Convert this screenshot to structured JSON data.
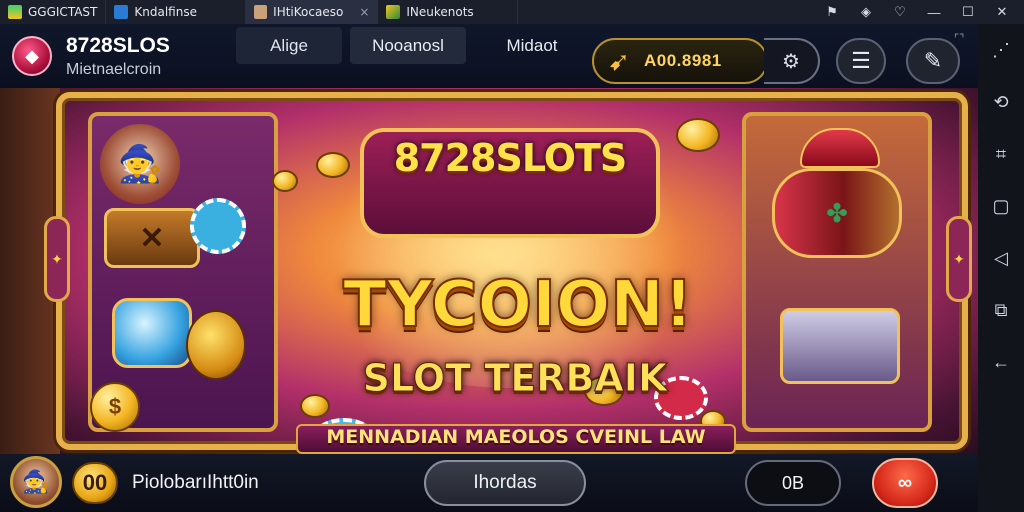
{
  "browser": {
    "tabs": [
      {
        "label": "GGGICTAST",
        "icon": "app-icon"
      },
      {
        "label": "Kndalfinse",
        "icon": "app-icon"
      },
      {
        "label": "IHtiKocaeso",
        "icon": "avatar-icon",
        "close": "×"
      },
      {
        "label": "INeukenots",
        "icon": "app-icon"
      }
    ],
    "window_controls": {
      "pin": "⚑",
      "tool": "◈",
      "heart": "♡",
      "minimize": "—",
      "maximize": "☐",
      "close": "✕"
    }
  },
  "header": {
    "brand_title": "8728SLOS",
    "brand_subtitle": "Mietnaelcroin",
    "nav": [
      "Alige",
      "Nooanosl",
      "Midaot"
    ],
    "coin_value": "A00.8981",
    "corner_ext": "⌜⌝"
  },
  "banner": {
    "brand": "8728SLOTS",
    "title": "TYCOION!",
    "subtitle": "SLOT TERBAIK",
    "tagline": "MENNADIAN MAEOLOS CVEINL LAW"
  },
  "bottom": {
    "badge": "00",
    "username": "PiolobarıIhtt0in",
    "main_button": "Ihordas",
    "small_button": "0B",
    "red_button": "∞"
  },
  "sidebar": {
    "icons": [
      "dots-icon",
      "rotate-icon",
      "crop-icon",
      "square-icon",
      "back-icon",
      "copy-icon",
      "arrow-left-icon"
    ]
  },
  "colors": {
    "accent_gold": "#e6b04a",
    "brand_pink": "#b0123e",
    "banner_center": "#ffd27a",
    "bar_dark": "#0b1020"
  }
}
